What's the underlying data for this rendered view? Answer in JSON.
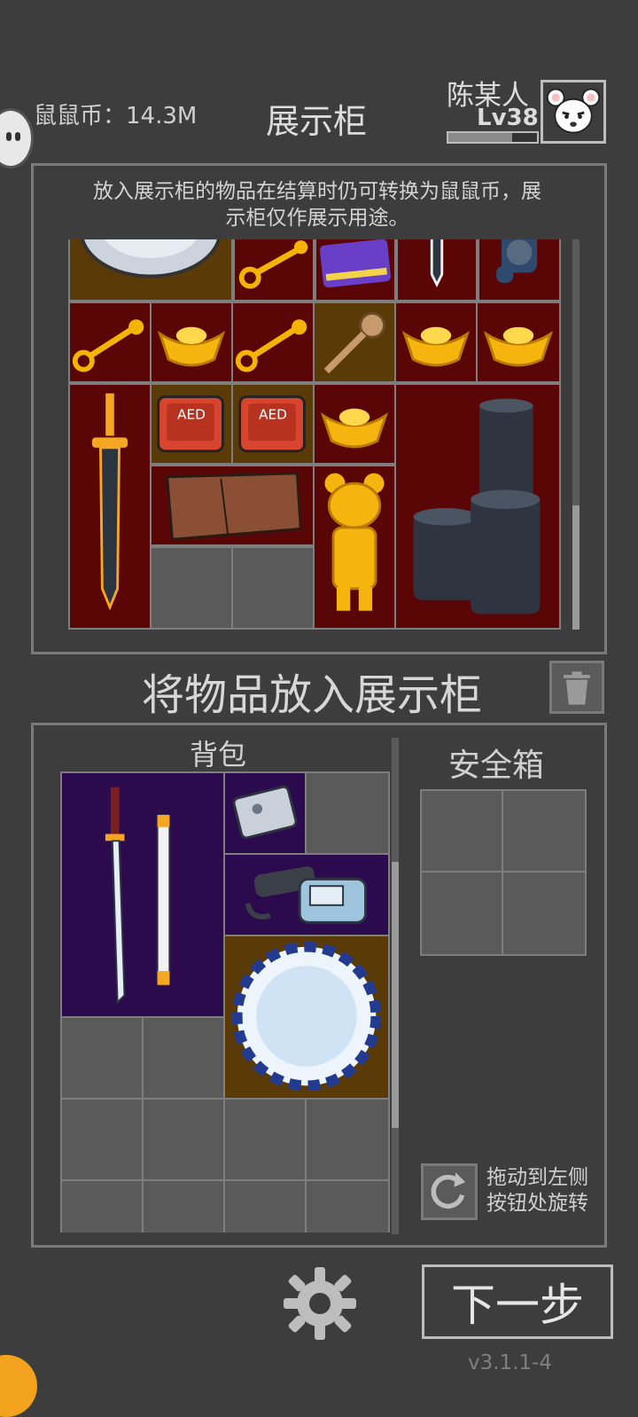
{
  "header": {
    "coins_label": "鼠鼠币：14.3M",
    "title": "展示柜",
    "player_name": "陈某人",
    "level": "Lv38",
    "xp_progress": 0.72
  },
  "showcase": {
    "notice": "放入展示柜的物品在结算时仍可转换为鼠鼠币，展示柜仅作展示用途。",
    "items": [
      "key-icon",
      "gold-ingot-icon",
      "brass-key-icon",
      "aed-icon",
      "sword-icon",
      "leather-folder-icon",
      "golden-bear-figure-icon",
      "metal-cylinders-icon",
      "keycard-icon",
      "dagger-icon",
      "watch-icon",
      "plate-icon"
    ]
  },
  "put_in_title": "将物品放入展示柜",
  "backpack": {
    "title": "背包",
    "items": [
      "katana-icon",
      "battery-pack-icon",
      "blood-pressure-monitor-icon",
      "porcelain-plate-icon"
    ]
  },
  "safebox": {
    "title": "安全箱"
  },
  "rotate_hint": "拖动到左侧按钮处旋转",
  "next_button": "下一步",
  "version": "v3.1.1-4"
}
